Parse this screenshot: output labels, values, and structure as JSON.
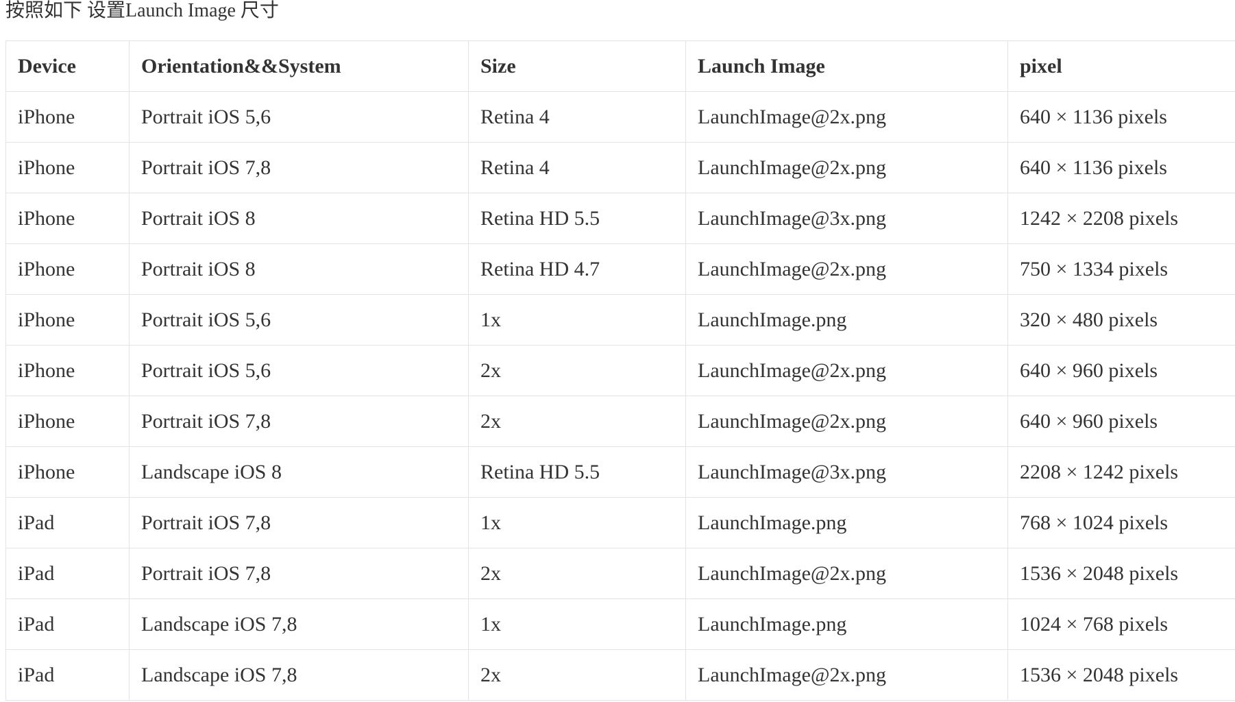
{
  "page": {
    "title": "按照如下 设置Launch Image 尺寸"
  },
  "table": {
    "headers": {
      "device": "Device",
      "orientation_system": "Orientation&&System",
      "size": "Size",
      "launch_image": "Launch Image",
      "pixel": "pixel"
    },
    "rows": [
      {
        "device": "iPhone",
        "orientation_system": "Portrait iOS 5,6",
        "size": "Retina 4",
        "launch_image": "LaunchImage@2x.png",
        "pixel": "640 × 1136 pixels"
      },
      {
        "device": "iPhone",
        "orientation_system": "Portrait iOS 7,8",
        "size": "Retina 4",
        "launch_image": "LaunchImage@2x.png",
        "pixel": "640 × 1136 pixels"
      },
      {
        "device": "iPhone",
        "orientation_system": "Portrait iOS 8",
        "size": "Retina HD 5.5",
        "launch_image": "LaunchImage@3x.png",
        "pixel": "1242 × 2208 pixels"
      },
      {
        "device": "iPhone",
        "orientation_system": "Portrait iOS 8",
        "size": "Retina HD 4.7",
        "launch_image": "LaunchImage@2x.png",
        "pixel": "750 × 1334 pixels"
      },
      {
        "device": "iPhone",
        "orientation_system": "Portrait iOS 5,6",
        "size": "1x",
        "launch_image": "LaunchImage.png",
        "pixel": "320 × 480 pixels"
      },
      {
        "device": "iPhone",
        "orientation_system": "Portrait iOS 5,6",
        "size": "2x",
        "launch_image": "LaunchImage@2x.png",
        "pixel": "640 × 960 pixels"
      },
      {
        "device": "iPhone",
        "orientation_system": "Portrait iOS 7,8",
        "size": "2x",
        "launch_image": "LaunchImage@2x.png",
        "pixel": "640 × 960 pixels"
      },
      {
        "device": "iPhone",
        "orientation_system": "Landscape iOS 8",
        "size": "Retina HD 5.5",
        "launch_image": "LaunchImage@3x.png",
        "pixel": "2208 × 1242 pixels"
      },
      {
        "device": "iPad",
        "orientation_system": "Portrait iOS 7,8",
        "size": "1x",
        "launch_image": "LaunchImage.png",
        "pixel": "768 × 1024 pixels"
      },
      {
        "device": "iPad",
        "orientation_system": "Portrait iOS 7,8",
        "size": "2x",
        "launch_image": "LaunchImage@2x.png",
        "pixel": "1536 × 2048 pixels"
      },
      {
        "device": "iPad",
        "orientation_system": "Landscape iOS 7,8",
        "size": "1x",
        "launch_image": "LaunchImage.png",
        "pixel": "1024 × 768 pixels"
      },
      {
        "device": "iPad",
        "orientation_system": "Landscape iOS 7,8",
        "size": "2x",
        "launch_image": "LaunchImage@2x.png",
        "pixel": "1536 × 2048 pixels"
      }
    ]
  }
}
